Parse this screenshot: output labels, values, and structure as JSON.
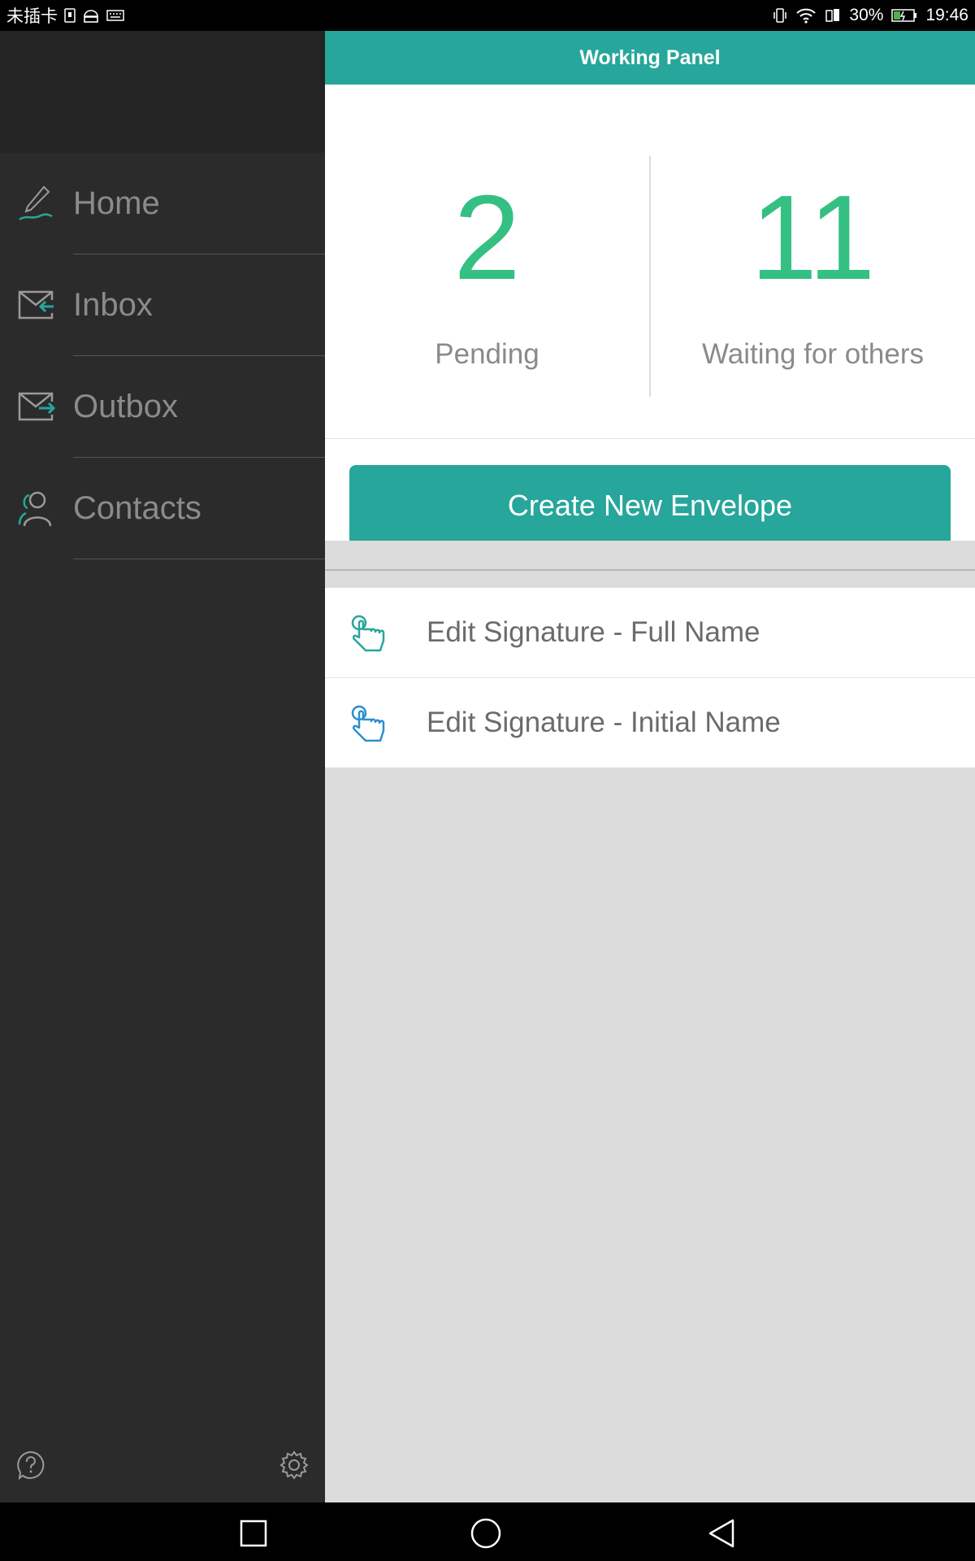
{
  "status_bar": {
    "carrier": "未插卡",
    "battery": "30%",
    "time": "19:46"
  },
  "drawer": {
    "items": [
      {
        "label": "Home",
        "icon": "pen-signature-icon"
      },
      {
        "label": "Inbox",
        "icon": "inbox-envelope-icon"
      },
      {
        "label": "Outbox",
        "icon": "outbox-envelope-icon"
      },
      {
        "label": "Contacts",
        "icon": "contacts-icon"
      }
    ],
    "bottom_icons": [
      "help-icon",
      "settings-gear-icon"
    ]
  },
  "main": {
    "title": "Working Panel",
    "stats": [
      {
        "value": "2",
        "label": "Pending"
      },
      {
        "value": "11",
        "label": "Waiting for others"
      }
    ],
    "create_button": "Create New Envelope",
    "list": [
      {
        "label": "Edit Signature - Full Name",
        "icon": "tap-hand-icon"
      },
      {
        "label": "Edit Signature - Initial Name",
        "icon": "tap-hand-icon"
      }
    ]
  },
  "colors": {
    "accent": "#27a69b",
    "stat_number": "#34c083",
    "drawer_bg": "#2c2b2c"
  }
}
